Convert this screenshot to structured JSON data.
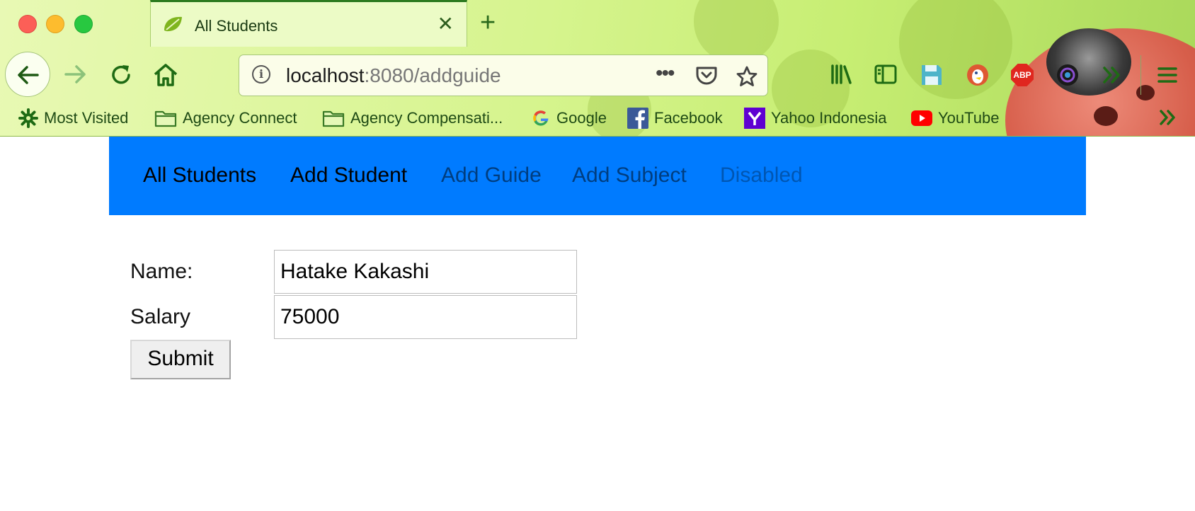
{
  "browser": {
    "tab": {
      "title": "All Students",
      "close_icon": "close-icon",
      "favicon": "spring-leaf-icon"
    },
    "new_tab_icon": "plus-icon",
    "url": {
      "host": "localhost",
      "rest": ":8080/addguide"
    },
    "icons": {
      "back": "arrow-left-icon",
      "forward": "arrow-right-icon",
      "reload": "reload-icon",
      "home": "home-icon",
      "info": "info-icon",
      "page_actions": "more-dots-icon",
      "pocket": "pocket-icon",
      "bookmark_star": "star-icon",
      "library": "library-icon",
      "sidebar": "sidebar-icon",
      "save": "floppy-disk-icon",
      "duckduckgo": "duckduckgo-icon",
      "adblock": "adblock-icon",
      "camera": "camera-lens-icon",
      "overflow": "chevron-double-right-icon",
      "menu": "hamburger-menu-icon"
    },
    "adblock_label": "ABP",
    "bookmarks": [
      {
        "label": "Most Visited",
        "icon": "gear-icon"
      },
      {
        "label": "Agency Connect",
        "icon": "folder-icon"
      },
      {
        "label": "Agency Compensati...",
        "icon": "folder-icon"
      },
      {
        "label": "Google",
        "icon": "google-icon"
      },
      {
        "label": "Facebook",
        "icon": "facebook-icon"
      },
      {
        "label": "Yahoo Indonesia",
        "icon": "yahoo-icon"
      },
      {
        "label": "YouTube",
        "icon": "youtube-icon"
      }
    ],
    "colors": {
      "tab_accent": "#2c7a1f",
      "theme_green": "#d6f48e"
    }
  },
  "navbar": {
    "background": "#007bff",
    "links": [
      {
        "label": "All Students",
        "state": "active"
      },
      {
        "label": "Add Student",
        "state": "active"
      },
      {
        "label": "Add Guide",
        "state": "inactive"
      },
      {
        "label": "Add Subject",
        "state": "inactive"
      },
      {
        "label": "Disabled",
        "state": "disabled"
      }
    ]
  },
  "form": {
    "name_label": "Name:",
    "name_value": "Hatake Kakashi",
    "salary_label": "Salary",
    "salary_value": "75000",
    "submit_label": "Submit"
  }
}
